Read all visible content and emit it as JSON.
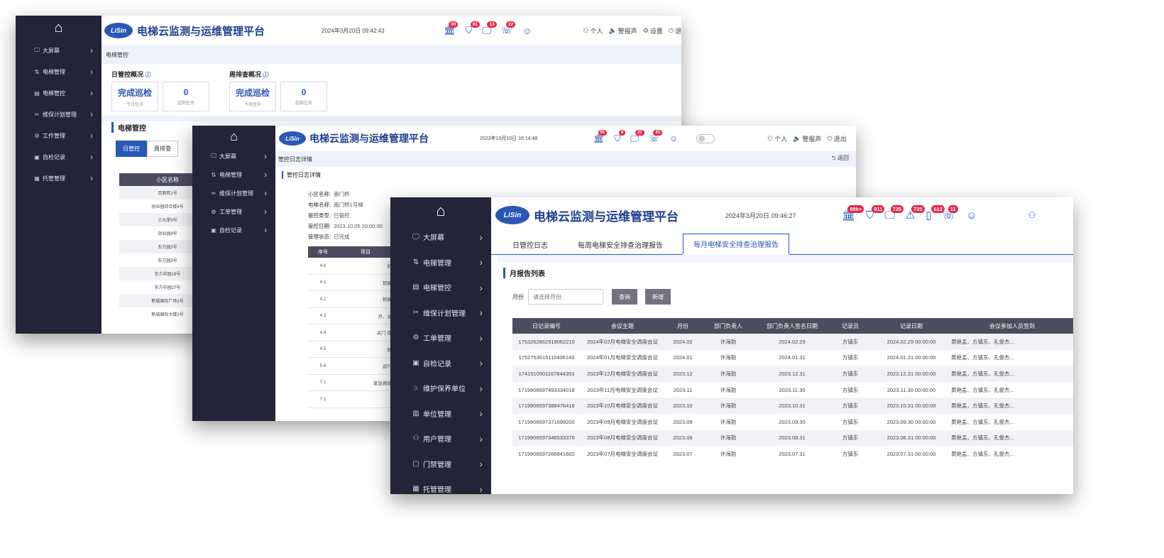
{
  "app": {
    "logo": "LiSin",
    "title": "电梯云监测与运维管理平台",
    "colors": {
      "primary": "#2b57b6",
      "sidebar": "#242438",
      "badge": "#e8284a",
      "table_header": "#4c4c5e"
    }
  },
  "window1": {
    "time": "2024年3月20日 09:42:43",
    "badges": [
      "90",
      "91",
      "13",
      "22"
    ],
    "toplinks": [
      "个人",
      "警报声",
      "设置",
      "退"
    ],
    "sidebar": [
      "大屏幕",
      "电梯管理",
      "电梯管控",
      "维保计划管理",
      "工作管理",
      "自检记录",
      "托管管理"
    ],
    "breadcrumb": "电梯管控",
    "daily_title": "日管控概况",
    "weekly_title": "周排查概况",
    "daily_stats": [
      {
        "value": "完成巡检",
        "label": "今日任务"
      },
      {
        "value": "0",
        "label": "超期任务"
      }
    ],
    "weekly_stats": [
      {
        "value": "完成巡检",
        "label": "今周任务"
      },
      {
        "value": "0",
        "label": "超期任务"
      }
    ],
    "section_title": "电梯管控",
    "tabs": [
      "日管控",
      "周排查"
    ],
    "table_header": "小区名称",
    "rows": [
      "百丽苑1号",
      "创业园综合楼4号",
      "三元里9号",
      "创业园9号",
      "东方园2号",
      "东方园3号",
      "东方中园19号",
      "东方中园27号",
      "新城国际广场1号",
      "新城国际大楼1号"
    ]
  },
  "window2": {
    "time": "2023年10月10日 16:14:48",
    "badges": [
      "91",
      "8",
      "22",
      "41"
    ],
    "toplinks": [
      "个人",
      "警报声",
      "退出"
    ],
    "sidebar": [
      "大屏幕",
      "电梯管理",
      "维保计划管理",
      "工单管理",
      "自检记录"
    ],
    "breadcrumb": "管控日志详情",
    "back": "返回",
    "section_title": "管控日志详情",
    "fields": [
      {
        "label": "小区名称:",
        "value": "南门桥"
      },
      {
        "label": "电梯名称:",
        "value": "南门桥1号梯"
      },
      {
        "label": "管控类型:",
        "value": "日管控"
      },
      {
        "label": "管控日期:",
        "value": "2023.10.05 20:00:00"
      },
      {
        "label": "管理状态:",
        "value": "已完成"
      }
    ],
    "table_headers": [
      "序号",
      "项目"
    ],
    "rows": [
      {
        "no": "4.6",
        "item": "机"
      },
      {
        "no": "4.1",
        "item": "轿厢"
      },
      {
        "no": "4.2",
        "item": "轿厢"
      },
      {
        "no": "4.3",
        "item": "开、关"
      },
      {
        "no": "4.4",
        "item": "关门 保"
      },
      {
        "no": "4.5",
        "item": "轿"
      },
      {
        "no": "5.6",
        "item": "运行"
      },
      {
        "no": "7.1",
        "item": "紧急救援"
      },
      {
        "no": "7.1",
        "item": ""
      }
    ]
  },
  "window3": {
    "time": "2024年3月20日 09:46:27",
    "badges": [
      "88k+",
      "911",
      "735",
      "735",
      "612",
      "11"
    ],
    "sidebar": [
      "大屏幕",
      "电梯管理",
      "电梯管控",
      "维保计划管理",
      "工单管理",
      "自检记录",
      "维护保养单位",
      "单位管理",
      "用户管理",
      "门禁管理",
      "托管管理"
    ],
    "tabs": [
      "日管控日志",
      "每周电梯安全排查治理报告",
      "每月电梯安全排查治理报告"
    ],
    "active_tab": 2,
    "section_title": "月报告列表",
    "month_label": "月份",
    "month_placeholder": "请选择月份",
    "query_btn": "查询",
    "add_btn": "新增",
    "columns": [
      "日记录编号",
      "会议主题",
      "月份",
      "部门负责人",
      "部门负责人签名日期",
      "记录员",
      "记录日期",
      "会议参加人员签到"
    ],
    "rows": [
      [
        "1753262862919062210",
        "2024年02月电梯安全调度会议",
        "2024.02",
        "许海勃",
        "2024.02.29",
        "方镇东",
        "2024.02.29 00:00:00",
        "黄继孟、方镇东、孔俊杰..."
      ],
      [
        "1752753615110406146",
        "2024年01月电梯安全调度会议",
        "2024.01",
        "许海勃",
        "2024.01.31",
        "方镇东",
        "2024.01.31 00:00:00",
        "黄继孟、方镇东、孔俊杰..."
      ],
      [
        "1741510501167844353",
        "2023年12月电梯安全调度会议",
        "2023.12",
        "许海勃",
        "2023.12.31",
        "方镇东",
        "2023.12.31 00:00:00",
        "黄继孟、方镇东、孔俊杰..."
      ],
      [
        "1719906597493334018",
        "2023年11月电梯安全调度会议",
        "2023.11",
        "许海勃",
        "2023.11.30",
        "方镇东",
        "2023.11.30 00:00:00",
        "黄继孟、方镇东、孔俊杰..."
      ],
      [
        "1719906597388476418",
        "2023年10月电梯安全调度会议",
        "2023.10",
        "许海勃",
        "2023.10.31",
        "方镇东",
        "2023.10.31 00:00:00",
        "黄继孟、方镇东、孔俊杰..."
      ],
      [
        "1719906597371699200",
        "2023年09月电梯安全调度会议",
        "2023.09",
        "许海勃",
        "2023.09.30",
        "方镇东",
        "2023.09.30 00:00:00",
        "黄继孟、方镇东、孔俊杰..."
      ],
      [
        "1719906597346533378",
        "2023年08月电梯安全调度会议",
        "2023.08",
        "许海勃",
        "2023.08.31",
        "方镇东",
        "2023.08.31 00:00:00",
        "黄继孟、方镇东、孔俊杰..."
      ],
      [
        "1719906597266841602",
        "2023年07月电梯安全调度会议",
        "2023.07",
        "许海勃",
        "2023.07.31",
        "方镇东",
        "2023.07.31 00:00:00",
        "黄继孟、方镇东、孔俊杰..."
      ]
    ]
  }
}
